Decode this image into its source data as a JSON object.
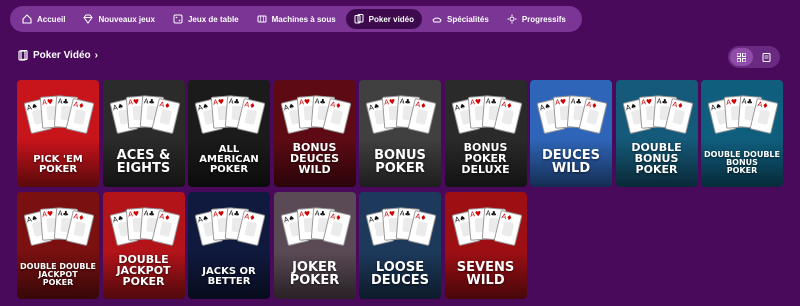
{
  "nav": {
    "items": [
      {
        "label": "Accueil",
        "icon": "home-icon"
      },
      {
        "label": "Nouveaux jeux",
        "icon": "diamond-icon"
      },
      {
        "label": "Jeux de table",
        "icon": "dice-icon"
      },
      {
        "label": "Machines à sous",
        "icon": "slot-icon"
      },
      {
        "label": "Poker vidéo",
        "icon": "cards-icon",
        "active": true
      },
      {
        "label": "Spécialités",
        "icon": "ticket-icon"
      },
      {
        "label": "Progressifs",
        "icon": "sparkle-icon"
      }
    ]
  },
  "section": {
    "title": "Poker Vidéo",
    "chevron": "›"
  },
  "view_toggle": {
    "grid_icon": "grid-icon",
    "list_icon": "list-icon"
  },
  "games": [
    {
      "title": "PICK 'EM\nPOKER",
      "bg": "#c8141b"
    },
    {
      "title": "ACES &\nEIGHTS",
      "bg": "#2b2b2b"
    },
    {
      "title": "ALL\nAMERICAN\nPOKER",
      "bg": "#1b1b1b"
    },
    {
      "title": "BONUS\nDEUCES\nWILD",
      "bg": "#5e0a14"
    },
    {
      "title": "BONUS\nPOKER",
      "bg": "#404040"
    },
    {
      "title": "BONUS\nPOKER\nDELUXE",
      "bg": "#2a2a2a"
    },
    {
      "title": "DEUCES\nWILD",
      "bg": "#2f65b8"
    },
    {
      "title": "DOUBLE\nBONUS\nPOKER",
      "bg": "#155a7a"
    },
    {
      "title": "DOUBLE DOUBLE\nBONUS\nPOKER",
      "bg": "#0f5e7e"
    },
    {
      "title": "DOUBLE DOUBLE\nJACKPOT\nPOKER",
      "bg": "#7a1010"
    },
    {
      "title": "DOUBLE\nJACKPOT\nPOKER",
      "bg": "#b3141a"
    },
    {
      "title": "JACKS OR\nBETTER",
      "bg": "#101a3e"
    },
    {
      "title": "JOKER\nPOKER",
      "bg": "#5a4a55"
    },
    {
      "title": "LOOSE\nDEUCES",
      "bg": "#1d3a5c"
    },
    {
      "title": "SEVENS\nWILD",
      "bg": "#9e0f14"
    }
  ]
}
